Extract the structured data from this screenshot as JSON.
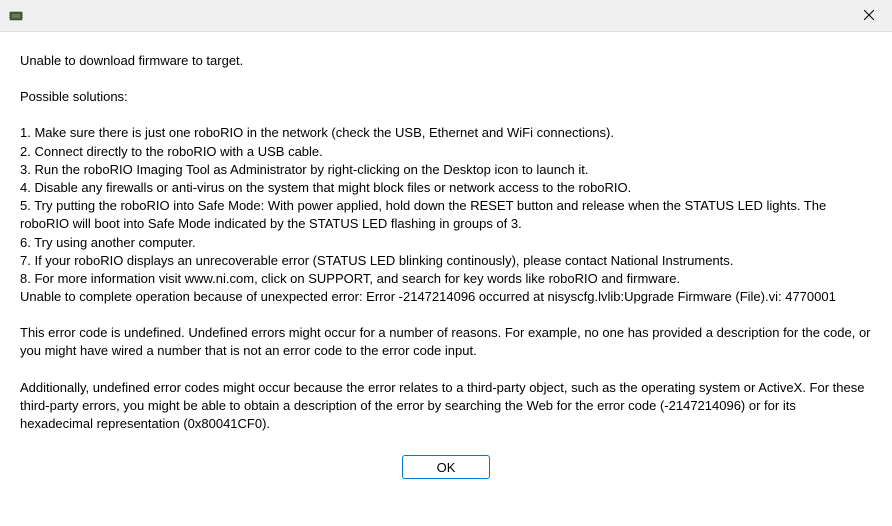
{
  "titlebar": {
    "icon_name": "app-icon"
  },
  "content": {
    "main_error": "Unable to download firmware to target.",
    "solutions_header": "Possible solutions:",
    "solutions": [
      "1. Make sure there is just one roboRIO in the network (check the USB, Ethernet and WiFi connections).",
      "2. Connect directly to the roboRIO with a USB cable.",
      "3. Run the roboRIO Imaging Tool as Administrator by right-clicking on the Desktop icon to launch it.",
      "4. Disable any firewalls or anti-virus on the system that might block files or network access to the roboRIO.",
      "5. Try putting the roboRIO into Safe Mode: With power applied, hold down the RESET button and release when the STATUS LED lights. The roboRIO will boot into Safe Mode indicated by the STATUS LED flashing in groups of 3.",
      "6. Try using another computer.",
      "7. If your roboRIO displays an unrecoverable error (STATUS LED blinking continously), please contact National Instruments.",
      "8. For more information visit  www.ni.com, click on SUPPORT, and search for key words like roboRIO and firmware."
    ],
    "error_detail": "Unable to complete operation because of unexpected error: Error -2147214096 occurred at nisyscfg.lvlib:Upgrade Firmware (File).vi: 4770001",
    "undefined_error": "This error code is undefined. Undefined errors might occur for a number of reasons. For example, no one has provided a description for the code, or you might have wired a number that is not an error code to the error code input.",
    "additional_info": "Additionally, undefined error codes might occur because the error relates to a third-party object, such as the operating system or ActiveX. For these third-party errors, you might be able to obtain a description of the error by searching the Web for the error code (-2147214096) or for its hexadecimal representation (0x80041CF0)."
  },
  "buttons": {
    "ok_label": "OK"
  }
}
